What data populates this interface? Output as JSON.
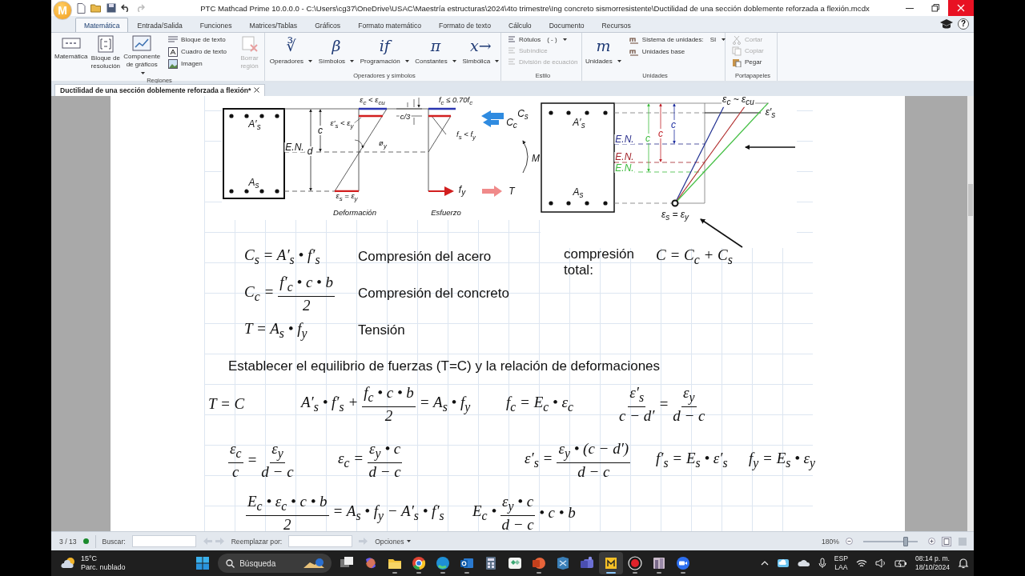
{
  "window": {
    "logo": "M",
    "title": "PTC Mathcad Prime 10.0.0.0 - C:\\Users\\cg37\\OneDrive\\USAC\\Maestría estructuras\\2024\\4to trimestre\\Ing concreto sismorresistente\\Ductilidad de una sección doblemente reforzada a flexión.mcdx"
  },
  "ribbon": {
    "tabs": [
      {
        "label": "Matemática",
        "selected": true
      },
      {
        "label": "Entrada/Salida",
        "selected": false
      },
      {
        "label": "Funciones",
        "selected": false
      },
      {
        "label": "Matrices/Tablas",
        "selected": false
      },
      {
        "label": "Gráficos",
        "selected": false
      },
      {
        "label": "Formato matemático",
        "selected": false
      },
      {
        "label": "Formato de texto",
        "selected": false
      },
      {
        "label": "Cálculo",
        "selected": false
      },
      {
        "label": "Documento",
        "selected": false
      },
      {
        "label": "Recursos",
        "selected": false
      }
    ],
    "help": "?",
    "regiones": {
      "label": "Regiones",
      "large": [
        {
          "kind": "math",
          "label": "Matemática",
          "dropdown": false
        },
        {
          "kind": "solve",
          "label": "Bloque de resolución",
          "dropdown": false
        },
        {
          "kind": "chart",
          "label": "Componente de gráficos",
          "dropdown": true
        }
      ],
      "small": [
        {
          "kind": "text_block",
          "label": "Bloque de texto"
        },
        {
          "kind": "text_box",
          "label": "Cuadro de texto"
        },
        {
          "kind": "image",
          "label": "Imagen"
        }
      ],
      "delete": {
        "label": "Borrar región",
        "disabled": true
      }
    },
    "operadores": {
      "label": "Operadores y símbolos",
      "items": [
        {
          "glyph": "∛",
          "label": "Operadores"
        },
        {
          "glyph": "β",
          "label": "Símbolos"
        },
        {
          "glyph": "if",
          "label": "Programación"
        },
        {
          "glyph": "π",
          "label": "Constantes"
        },
        {
          "glyph": "x→",
          "label": "Simbólica"
        }
      ]
    },
    "estilo": {
      "label": "Estilo",
      "items": [
        {
          "label": "Rótulos",
          "value": "( - )",
          "disabled": false
        },
        {
          "label": "Subíndice",
          "disabled": true
        },
        {
          "label": "División de ecuación",
          "disabled": true
        }
      ]
    },
    "unidades": {
      "label": "Unidades",
      "glyph": "m",
      "button": "Unidades",
      "items": [
        {
          "label": "Sistema de unidades:",
          "value": "SI"
        },
        {
          "label": "Unidades base"
        }
      ]
    },
    "portapapeles": {
      "label": "Portapapeles",
      "items": [
        {
          "kind": "cut",
          "label": "Cortar",
          "disabled": true
        },
        {
          "kind": "copy",
          "label": "Copiar",
          "disabled": true
        },
        {
          "kind": "paste",
          "label": "Pegar",
          "disabled": false
        }
      ]
    }
  },
  "document_tab": {
    "title": "Ductilidad de una sección doblemente reforzada a flexión*"
  },
  "worksheet": {
    "figure_1": {
      "labels": {
        "a_top": "A′$_{s}$",
        "a_bot": "A$_{s}$",
        "c": "c",
        "d": "d",
        "en": "E.N.",
        "strain_top": "ε$_{c}$ < ε$_{cu}$",
        "strain_steel": "ε′$_{s}$ < ε$_{y}$",
        "phi": "ø$_{y}$",
        "strain_bot": "ε$_{s}$ = ε$_{y}$",
        "stress_top": "f$_{c}$ ≤ 0.70f$_{c}$",
        "c3": "c/3",
        "stress_steel": "f$_{s}$ < f$_{y}$",
        "fy": "f$_{y}$",
        "cs": "C$_{s}$",
        "cc": "C$_{c}$",
        "m": "M",
        "t": "T",
        "deformation": "Deformación",
        "stress": "Esfuerzo"
      }
    },
    "figure_2": {
      "labels": {
        "strain_top": "ε$_{c}$ ~ ε$_{cu}$",
        "strain_prime": "ε′$_{s}$",
        "a_top": "A′$_{s}$",
        "a_bot": "A$_{s}$",
        "en_blue": "E.N.",
        "en_red": "E.N.",
        "en_green": "E.N.",
        "c_green": "c",
        "c_red": "c",
        "c_blue": "c",
        "strain_bot": "ε$_{s}$ = ε$_{y}$"
      }
    },
    "definitions": [
      {
        "parts": [
          {
            "kind": "text",
            "text": "C$_{s}$ = A′$_{s}$ • f′$_{s}$"
          }
        ],
        "description": "Compresión del acero"
      },
      {
        "parts": [
          {
            "kind": "text",
            "text": "C$_{c}$ ="
          },
          {
            "kind": "frac",
            "num": "f′$_{c}$ • c • b",
            "den": "2"
          }
        ],
        "description": "Compresión del concreto"
      },
      {
        "parts": [
          {
            "kind": "text",
            "text": "T = A$_{s}$ • f$_{y}$"
          }
        ],
        "description": "Tensión"
      }
    ],
    "total": {
      "label": "compresión total:",
      "parts": [
        {
          "kind": "text",
          "text": "C = C$_{c}$ + C$_{s}$"
        }
      ]
    },
    "heading": "Establecer el equilibrio de fuerzas (T=C) y la relación de deformaciones",
    "row_1": [
      {
        "parts": [
          {
            "kind": "text",
            "text": "T = C"
          }
        ]
      },
      {
        "parts": [
          {
            "kind": "text",
            "text": "A′$_{s}$ • f′$_{s}$ +"
          },
          {
            "kind": "frac",
            "num": "f$_{c}$ • c • b",
            "den": "2"
          },
          {
            "kind": "text",
            "text": "= A$_{s}$ • f$_{y}$"
          }
        ]
      },
      {
        "parts": [
          {
            "kind": "text",
            "text": "f$_{c}$ = E$_{c}$ • ε$_{c}$"
          }
        ]
      },
      {
        "parts": [
          {
            "kind": "frac",
            "num": "ε′$_{s}$",
            "den": "c − d′"
          },
          {
            "kind": "text",
            "text": "="
          },
          {
            "kind": "frac",
            "num": "ε$_{y}$",
            "den": "d − c"
          }
        ]
      }
    ],
    "row_2": [
      {
        "parts": [
          {
            "kind": "frac",
            "num": "ε$_{c}$",
            "den": "c"
          },
          {
            "kind": "text",
            "text": "="
          },
          {
            "kind": "frac",
            "num": "ε$_{y}$",
            "den": "d − c"
          }
        ]
      },
      {
        "parts": [
          {
            "kind": "text",
            "text": "ε$_{c}$ ="
          },
          {
            "kind": "frac",
            "num": "ε$_{y}$ • c",
            "den": "d − c"
          }
        ]
      },
      {
        "parts": [
          {
            "kind": "text",
            "text": "ε′$_{s}$ ="
          },
          {
            "kind": "frac",
            "num": "ε$_{y}$ • (c − d′)",
            "den": "d − c"
          }
        ]
      },
      {
        "parts": [
          {
            "kind": "text",
            "text": "f′$_{s}$ = E$_{s}$ • ε′$_{s}$"
          }
        ]
      },
      {
        "parts": [
          {
            "kind": "text",
            "text": "f$_{y}$ = E$_{s}$ • ε$_{y}$"
          }
        ]
      }
    ],
    "row_3": [
      {
        "parts": [
          {
            "kind": "frac",
            "num": "E$_{c}$ • ε$_{c}$ • c • b",
            "den": "2"
          },
          {
            "kind": "text",
            "text": "= A$_{s}$ • f$_{y}$ − A′$_{s}$ • f′$_{s}$"
          }
        ]
      },
      {
        "parts": [
          {
            "kind": "text",
            "text": "E$_{c}$ •"
          },
          {
            "kind": "frac",
            "num": "ε$_{y}$ • c",
            "den": "d − c"
          },
          {
            "kind": "text",
            "text": "• c • b"
          }
        ]
      }
    ]
  },
  "status_bar": {
    "page": "3 / 13",
    "find_label": "Buscar:",
    "replace_label": "Reemplazar por:",
    "options": "Opciones",
    "zoom": "180%",
    "zoom_slider": {
      "level": 0.78
    }
  },
  "taskbar": {
    "weather": {
      "temperature": "15°C",
      "condition": "Parc. nublado"
    },
    "search": {
      "placeholder": "Búsqueda"
    },
    "apps": [
      {
        "kind": "task_view",
        "running": false,
        "selected": false
      },
      {
        "kind": "copilot",
        "running": false,
        "selected": false
      },
      {
        "kind": "folder",
        "running": true,
        "selected": false
      },
      {
        "kind": "chrome",
        "running": true,
        "selected": false
      },
      {
        "kind": "edge",
        "running": true,
        "selected": false
      },
      {
        "kind": "outlook",
        "running": true,
        "selected": false
      },
      {
        "kind": "calculator",
        "running": false,
        "selected": false
      },
      {
        "kind": "green_app",
        "running": false,
        "selected": false
      },
      {
        "kind": "powerpoint",
        "running": true,
        "selected": false
      },
      {
        "kind": "s_app",
        "running": false,
        "selected": false
      },
      {
        "kind": "teams",
        "running": false,
        "selected": false
      },
      {
        "kind": "mathcad",
        "running": true,
        "selected": true
      },
      {
        "kind": "recorder",
        "running": true,
        "selected": false
      },
      {
        "kind": "photos",
        "running": true,
        "selected": false
      },
      {
        "kind": "zoom",
        "running": true,
        "selected": false
      }
    ],
    "tray": {
      "language": "ESP",
      "layout": "LAA",
      "time": "08:14 p. m.",
      "date": "18/10/2024"
    }
  }
}
